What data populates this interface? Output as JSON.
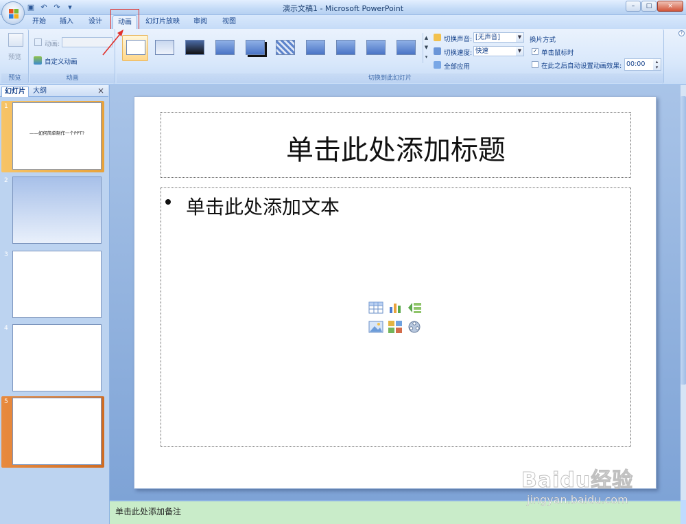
{
  "window": {
    "title": "演示文稿1 - Microsoft PowerPoint",
    "controls": [
      "–",
      "□",
      "×"
    ]
  },
  "qat": {
    "icons": [
      "save-icon",
      "undo-icon",
      "redo-icon",
      "customize-icon"
    ],
    "undo_glyph": "↶",
    "redo_glyph": "↷",
    "save_glyph": "▣",
    "more_glyph": "▾"
  },
  "tabs": [
    {
      "label": "开始"
    },
    {
      "label": "插入"
    },
    {
      "label": "设计"
    },
    {
      "label": "动画",
      "active": true
    },
    {
      "label": "幻灯片放映"
    },
    {
      "label": "审阅"
    },
    {
      "label": "视图"
    }
  ],
  "ribbon": {
    "preview": {
      "button": "预览",
      "group": "预览"
    },
    "animation": {
      "anim_label": "动画:",
      "custom_anim": "自定义动画",
      "group": "动画"
    },
    "transition": {
      "sound_label": "切换声音:",
      "sound_value": "[无声音]",
      "speed_label": "切换速度:",
      "speed_value": "快速",
      "apply_all": "全部应用",
      "advance_title": "换片方式",
      "on_click": "单击鼠标时",
      "on_click_checked": true,
      "auto_after": "在此之后自动设置动画效果:",
      "auto_after_checked": false,
      "time_value": "00:00",
      "group": "切换到此幻灯片"
    }
  },
  "panel": {
    "tab_slides": "幻灯片",
    "tab_outline": "大纲",
    "close": "×",
    "slides": [
      {
        "num": "1",
        "text": "——如何简单制作一个PPT?"
      },
      {
        "num": "2",
        "text": ""
      },
      {
        "num": "3",
        "text": ""
      },
      {
        "num": "4",
        "text": ""
      },
      {
        "num": "5",
        "text": ""
      }
    ]
  },
  "slide": {
    "title_placeholder": "单击此处添加标题",
    "body_placeholder": "单击此处添加文本"
  },
  "notes": {
    "placeholder": "单击此处添加备注"
  },
  "watermark": {
    "brand": "Baidu经验",
    "url": "jingyan.baidu.com"
  },
  "colors": {
    "accent": "#15428b",
    "highlight": "#e0302a",
    "selected_slide": "#f7c466"
  }
}
